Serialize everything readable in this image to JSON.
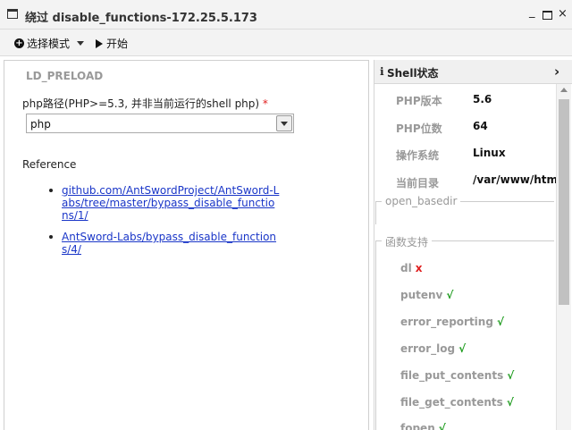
{
  "window": {
    "title": "绕过 disable_functions-172.25.5.173",
    "controls": {
      "minimize": "_",
      "close": "×"
    }
  },
  "toolbar": {
    "mode_label": "选择模式",
    "start_label": "开始"
  },
  "left_panel": {
    "section_title": "LD_PRELOAD",
    "php_path_label": "php路径(PHP>=5.3, 并非当前运行的shell php)",
    "required_mark": "*",
    "php_select_value": "php",
    "reference_title": "Reference",
    "references": [
      {
        "text": "github.com/AntSwordProject/AntSword-Labs/tree/master/bypass_disable_functions/1/"
      },
      {
        "text": "AntSword-Labs/bypass_disable_functions/4/"
      }
    ]
  },
  "right_panel": {
    "header_title": "Shell状态",
    "info_icon": "ℹ",
    "chevron": "›",
    "info": [
      {
        "key": "PHP版本",
        "value": "5.6"
      },
      {
        "key": "PHP位数",
        "value": "64"
      },
      {
        "key": "操作系统",
        "value": "Linux"
      },
      {
        "key": "当前目录",
        "value": "/var/www/htm"
      }
    ],
    "open_basedir_legend": "open_basedir",
    "functions_legend": "函数支持",
    "functions": [
      {
        "name": "dl",
        "mark": "x",
        "supported": false
      },
      {
        "name": "putenv",
        "mark": "√",
        "supported": true
      },
      {
        "name": "error_reporting",
        "mark": "√",
        "supported": true
      },
      {
        "name": "error_log",
        "mark": "√",
        "supported": true
      },
      {
        "name": "file_put_contents",
        "mark": "√",
        "supported": true
      },
      {
        "name": "file_get_contents",
        "mark": "√",
        "supported": true
      },
      {
        "name": "fopen",
        "mark": "√",
        "supported": true
      }
    ]
  },
  "colors": {
    "link": "#1a36c8",
    "supported": "#1a9a1a",
    "unsupported": "#e02020",
    "muted": "#999999"
  }
}
